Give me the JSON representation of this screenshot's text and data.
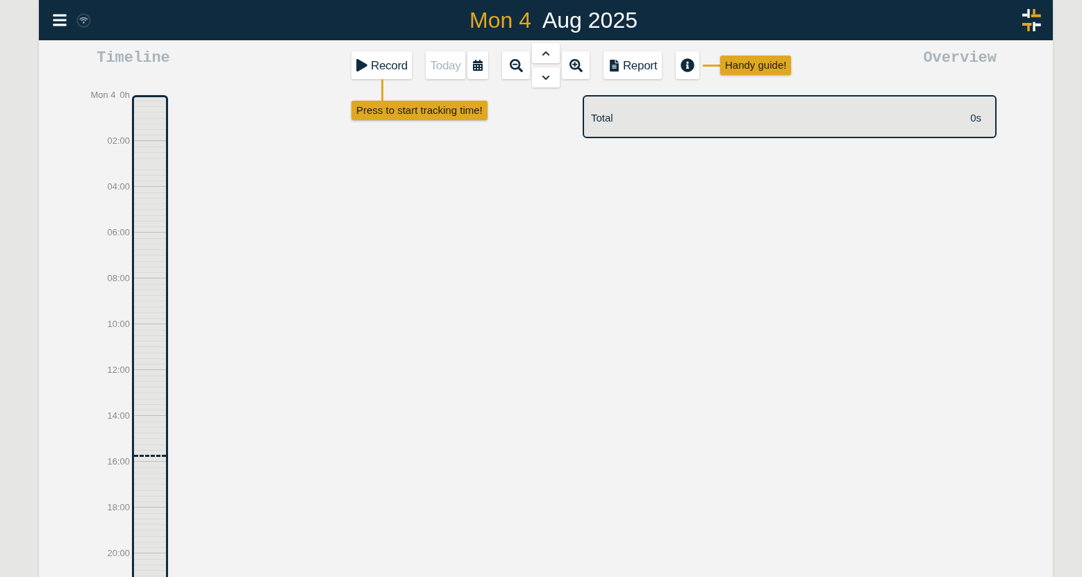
{
  "header": {
    "title_day": "Mon 4",
    "title_month_year": "Aug 2025"
  },
  "timeline": {
    "heading": "Timeline",
    "start_day": "Mon 4",
    "start_hour": "0h",
    "hour_labels": [
      "02:00",
      "04:00",
      "06:00",
      "08:00",
      "10:00",
      "12:00",
      "14:00",
      "16:00",
      "18:00",
      "20:00"
    ],
    "now_marker": {
      "level": 0.751
    }
  },
  "toolbar": {
    "groups": [
      {
        "buttons": [
          {
            "kind": "record",
            "label": "Record",
            "disabled": false,
            "tip": {
              "kind": "below",
              "text": "Press to start tracking time!"
            }
          }
        ]
      },
      {
        "buttons": [
          {
            "kind": "today",
            "label": "Today",
            "disabled": true
          },
          {
            "kind": "calendar",
            "disabled": false
          }
        ]
      },
      {
        "buttons": [
          {
            "kind": "zoom_out",
            "disabled": false
          },
          {
            "kind": "up",
            "disabled": false
          },
          {
            "kind": "down",
            "disabled": false
          },
          {
            "kind": "zoom_in",
            "disabled": false
          }
        ]
      },
      {
        "buttons": [
          {
            "kind": "report",
            "label": "Report",
            "disabled": false
          }
        ]
      },
      {
        "buttons": [
          {
            "kind": "info",
            "disabled": false,
            "tip": {
              "kind": "right",
              "text": "Handy guide!"
            }
          }
        ]
      }
    ]
  },
  "overview": {
    "heading": "Overview",
    "rows": [
      {
        "label": "Total",
        "value": "0s"
      }
    ]
  }
}
